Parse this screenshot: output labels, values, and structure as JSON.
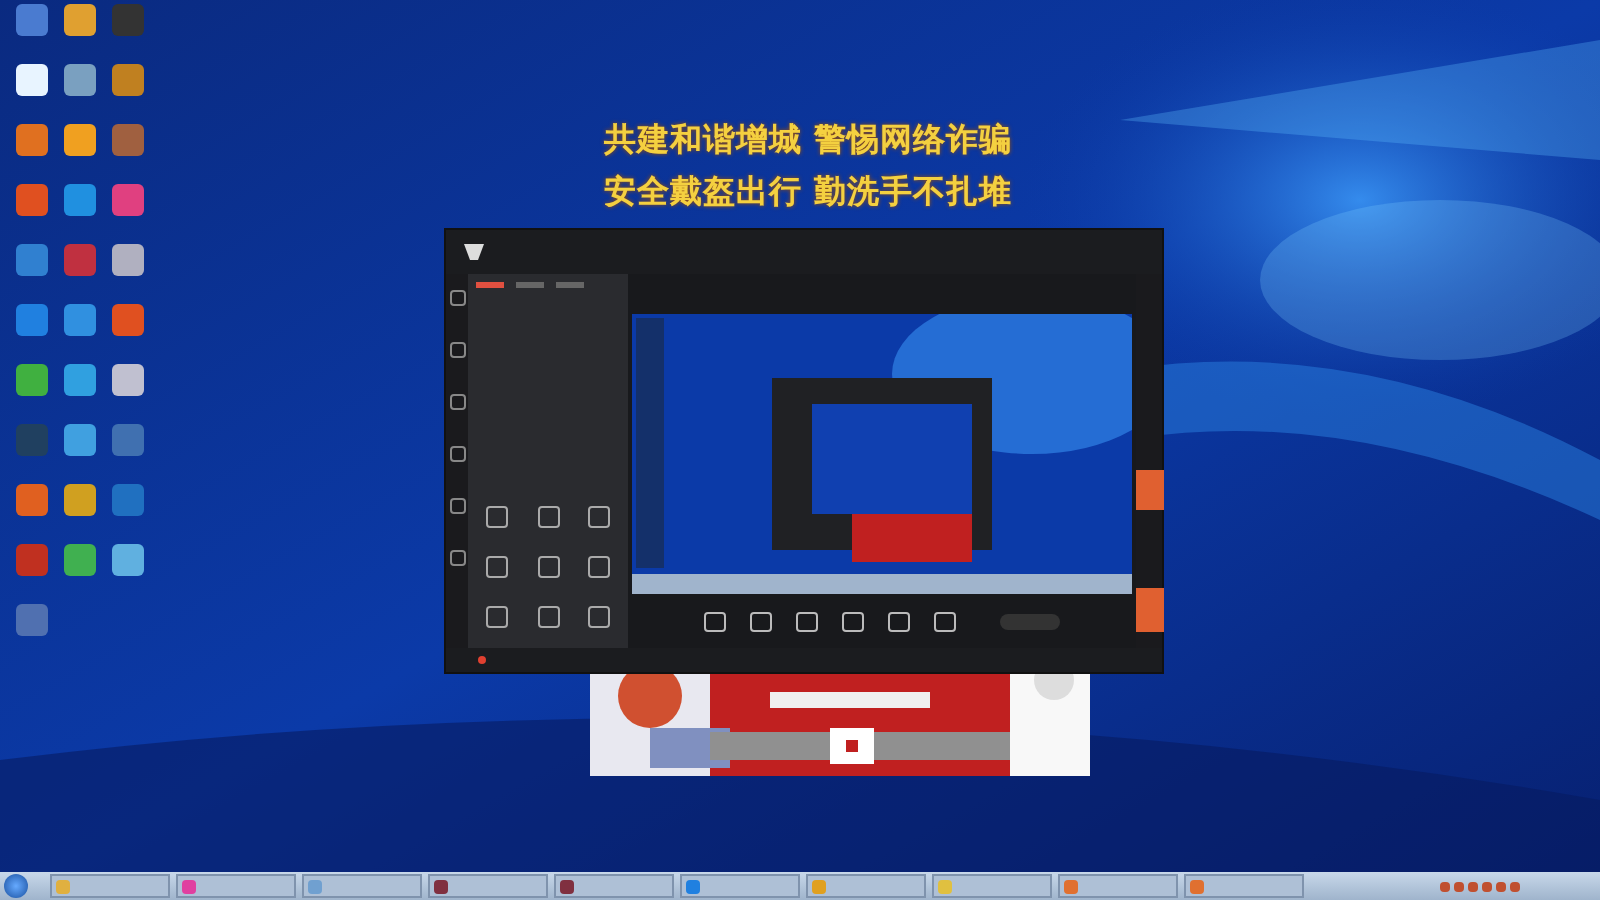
{
  "banner": {
    "lines": [
      "共建和谐增城 警惕网络诈骗",
      "安全戴盔出行 勤洗手不扎堆"
    ]
  },
  "panel_tabs": [
    {
      "selected": true
    },
    {
      "selected": false
    },
    {
      "selected": false
    }
  ]
}
